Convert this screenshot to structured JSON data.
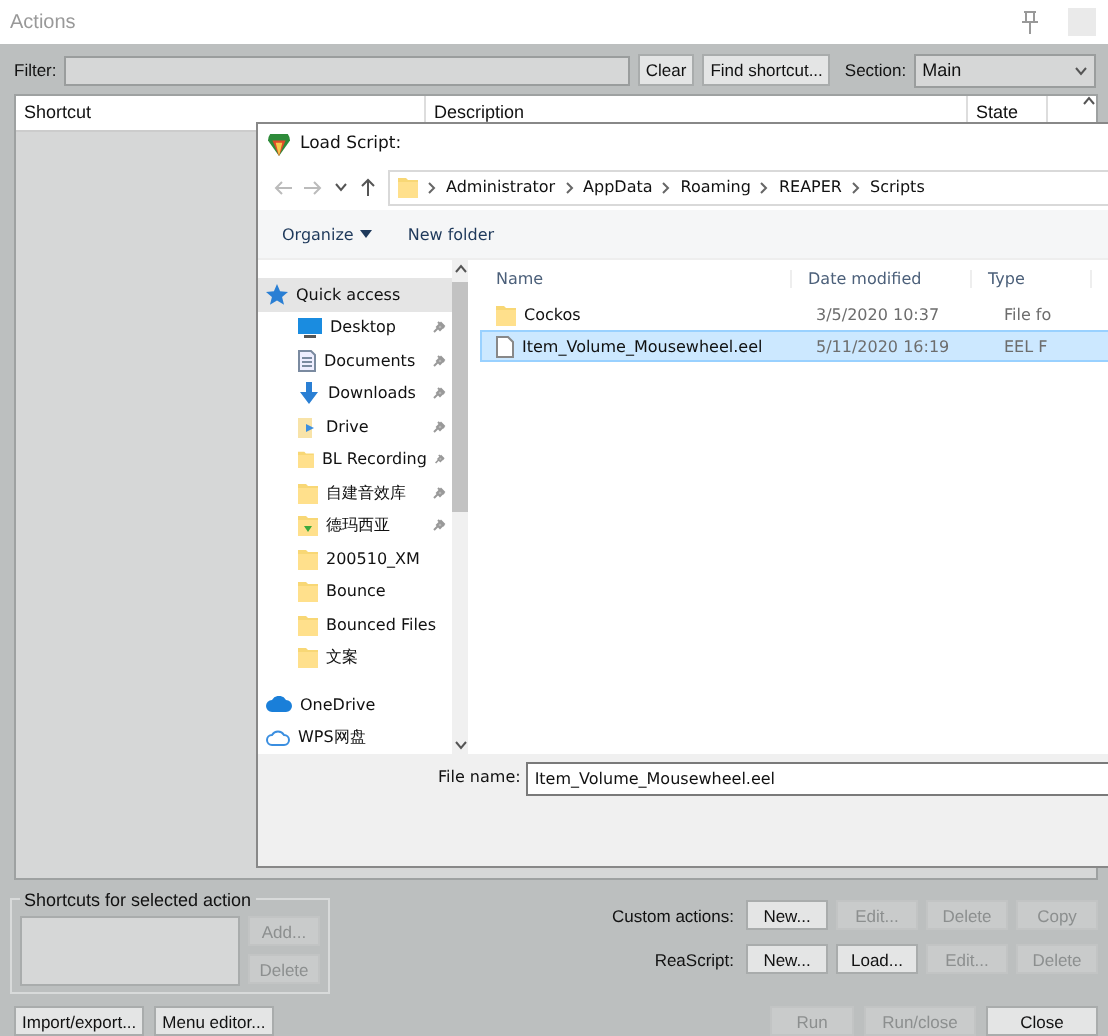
{
  "window": {
    "title": "Actions"
  },
  "filter": {
    "label": "Filter:"
  },
  "filter_buttons": [
    "Clear",
    "Find shortcut..."
  ],
  "section": {
    "label": "Section:",
    "value": "Main"
  },
  "table": {
    "columns": [
      "Shortcut",
      "Description",
      "State"
    ]
  },
  "dialog": {
    "title": "Load Script:",
    "path": [
      "Administrator",
      "AppData",
      "Roaming",
      "REAPER",
      "Scripts"
    ],
    "toolbar": [
      "Organize",
      "New folder"
    ],
    "sidebar": [
      {
        "label": "Quick access",
        "kind": "star",
        "pinned": false,
        "selected": true
      },
      {
        "label": "Desktop",
        "kind": "desktop",
        "pinned": true,
        "selected": false
      },
      {
        "label": "Documents",
        "kind": "document",
        "pinned": true,
        "selected": false
      },
      {
        "label": "Downloads",
        "kind": "download",
        "pinned": true,
        "selected": false
      },
      {
        "label": "Drive",
        "kind": "drive",
        "pinned": true,
        "selected": false
      },
      {
        "label": "BL Recording",
        "kind": "folder",
        "pinned": true,
        "selected": false
      },
      {
        "label": "自建音效库",
        "kind": "folder",
        "pinned": true,
        "selected": false
      },
      {
        "label": "德玛西亚",
        "kind": "folder-arrow",
        "pinned": true,
        "selected": false
      },
      {
        "label": "200510_XM",
        "kind": "folder",
        "pinned": false,
        "selected": false
      },
      {
        "label": "Bounce",
        "kind": "folder",
        "pinned": false,
        "selected": false
      },
      {
        "label": "Bounced Files",
        "kind": "folder",
        "pinned": false,
        "selected": false
      },
      {
        "label": "文案",
        "kind": "folder",
        "pinned": false,
        "selected": false
      },
      {
        "label": "OneDrive",
        "kind": "cloud",
        "pinned": false,
        "selected": false
      },
      {
        "label": "WPS网盘",
        "kind": "cloud-outline",
        "pinned": false,
        "selected": false
      }
    ],
    "columns": [
      "Name",
      "Date modified",
      "Type"
    ],
    "files": [
      {
        "name": "Cockos",
        "date": "3/5/2020 10:37",
        "type": "File fo",
        "kind": "folder",
        "selected": false
      },
      {
        "name": "Item_Volume_Mousewheel.eel",
        "date": "5/11/2020 16:19",
        "type": "EEL F",
        "kind": "file",
        "selected": true
      }
    ],
    "file_name": {
      "label": "File name:",
      "value": "Item_Volume_Mousewheel.eel"
    }
  },
  "shortcuts_group": {
    "title": "Shortcuts for selected action",
    "buttons": [
      {
        "label": "Add...",
        "disabled": true
      },
      {
        "label": "Delete",
        "disabled": true
      }
    ]
  },
  "action_rows": [
    {
      "label": "Custom actions:",
      "buttons": [
        {
          "label": "New...",
          "disabled": false
        },
        {
          "label": "Edit...",
          "disabled": true
        },
        {
          "label": "Delete",
          "disabled": true
        },
        {
          "label": "Copy",
          "disabled": true
        }
      ]
    },
    {
      "label": "ReaScript:",
      "buttons": [
        {
          "label": "New...",
          "disabled": false
        },
        {
          "label": "Load...",
          "disabled": false
        },
        {
          "label": "Edit...",
          "disabled": true
        },
        {
          "label": "Delete",
          "disabled": true
        }
      ]
    }
  ],
  "bottom_left": [
    {
      "label": "Import/export...",
      "disabled": false
    },
    {
      "label": "Menu editor...",
      "disabled": false
    }
  ],
  "bottom_right": [
    {
      "label": "Run",
      "disabled": true
    },
    {
      "label": "Run/close",
      "disabled": true
    },
    {
      "label": "Close",
      "disabled": false
    }
  ]
}
